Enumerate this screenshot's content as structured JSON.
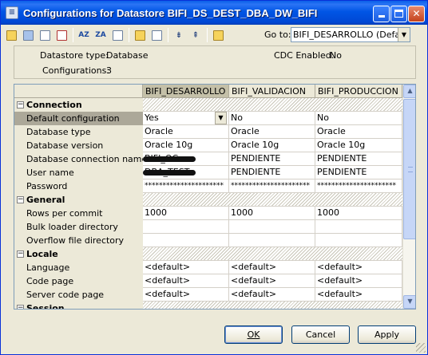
{
  "window": {
    "title": "Configurations for Datastore BIFI_DS_DEST_DBA_DW_BIFI",
    "icon": "datastore-icon"
  },
  "toolbar": {
    "goto_label": "Go to:",
    "goto_value": "BIFI_DESARROLLO (Defau",
    "sort_az_label": "AZ",
    "sort_za_label": "ZA"
  },
  "info": {
    "datastore_type_label": "Datastore type:",
    "datastore_type_value": "Database",
    "cdc_label": "CDC Enabled:",
    "cdc_value": "No",
    "configurations_label": "Configurations:",
    "configurations_value": "3"
  },
  "grid": {
    "columns": [
      "BIFI_DESARROLLO",
      "BIFI_VALIDACION",
      "BIFI_PRODUCCION"
    ],
    "sections": {
      "connection": "Connection",
      "general": "General",
      "locale": "Locale",
      "session": "Session"
    },
    "rows": {
      "default_configuration": {
        "label": "Default configuration",
        "values": [
          "Yes",
          "No",
          "No"
        ]
      },
      "database_type": {
        "label": "Database type",
        "values": [
          "Oracle",
          "Oracle",
          "Oracle"
        ]
      },
      "database_version": {
        "label": "Database version",
        "values": [
          "Oracle 10g",
          "Oracle 10g",
          "Oracle 10g"
        ]
      },
      "db_connection_name": {
        "label": "Database connection name",
        "values": [
          "BIFI_OC",
          "PENDIENTE",
          "PENDIENTE"
        ]
      },
      "user_name": {
        "label": "User name",
        "values": [
          "DBA_TEST",
          "PENDIENTE",
          "PENDIENTE"
        ]
      },
      "password": {
        "label": "Password",
        "values": [
          "**********************",
          "**********************",
          "**********************"
        ]
      },
      "rows_per_commit": {
        "label": "Rows per commit",
        "values": [
          "1000",
          "1000",
          "1000"
        ]
      },
      "bulk_loader_directory": {
        "label": "Bulk loader directory",
        "values": [
          "",
          "",
          ""
        ]
      },
      "overflow_file_directory": {
        "label": "Overflow file directory",
        "values": [
          "",
          "",
          ""
        ]
      },
      "language": {
        "label": "Language",
        "values": [
          "<default>",
          "<default>",
          "<default>"
        ]
      },
      "code_page": {
        "label": "Code page",
        "values": [
          "<default>",
          "<default>",
          "<default>"
        ]
      },
      "server_code_page": {
        "label": "Server code page",
        "values": [
          "<default>",
          "<default>",
          "<default>"
        ]
      }
    }
  },
  "buttons": {
    "ok": "OK",
    "cancel": "Cancel",
    "apply": "Apply"
  }
}
